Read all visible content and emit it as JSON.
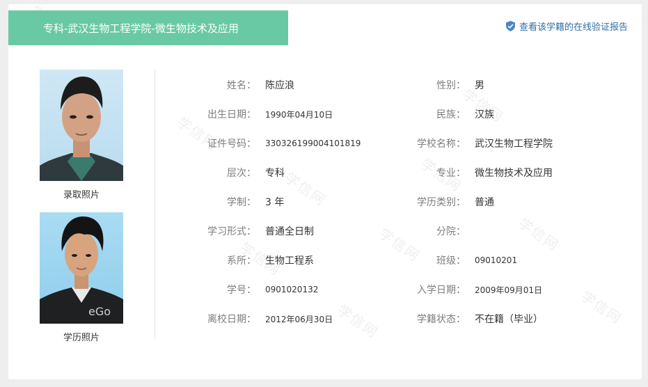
{
  "header": {
    "title": "专科-武汉生物工程学院-微生物技术及应用",
    "verify_link": "查看该学籍的在线验证报告"
  },
  "photos": {
    "admission_caption": "录取照片",
    "degree_caption": "学历照片"
  },
  "watermark_text": "学信网",
  "fields_left": [
    {
      "label": "姓名：",
      "value": "陈应浪"
    },
    {
      "label": "出生日期：",
      "value": "1990年04月10日"
    },
    {
      "label": "证件号码：",
      "value": "330326199004101819"
    },
    {
      "label": "层次：",
      "value": "专科"
    },
    {
      "label": "学制：",
      "value": "3 年"
    },
    {
      "label": "学习形式：",
      "value": "普通全日制"
    },
    {
      "label": "系所：",
      "value": "生物工程系"
    },
    {
      "label": "学号：",
      "value": "0901020132"
    },
    {
      "label": "离校日期：",
      "value": "2012年06月30日"
    }
  ],
  "fields_right": [
    {
      "label": "性别：",
      "value": "男"
    },
    {
      "label": "民族：",
      "value": "汉族"
    },
    {
      "label": "学校名称：",
      "value": "武汉生物工程学院"
    },
    {
      "label": "专业：",
      "value": "微生物技术及应用"
    },
    {
      "label": "学历类别：",
      "value": "普通"
    },
    {
      "label": "分院：",
      "value": ""
    },
    {
      "label": "班级：",
      "value": "09010201"
    },
    {
      "label": "入学日期：",
      "value": "2009年09月01日"
    },
    {
      "label": "学籍状态：",
      "value": "不在籍（毕业）"
    }
  ],
  "colors": {
    "banner": "#69c9a4",
    "link": "#2f6fa8",
    "label": "#7d7d7d"
  }
}
